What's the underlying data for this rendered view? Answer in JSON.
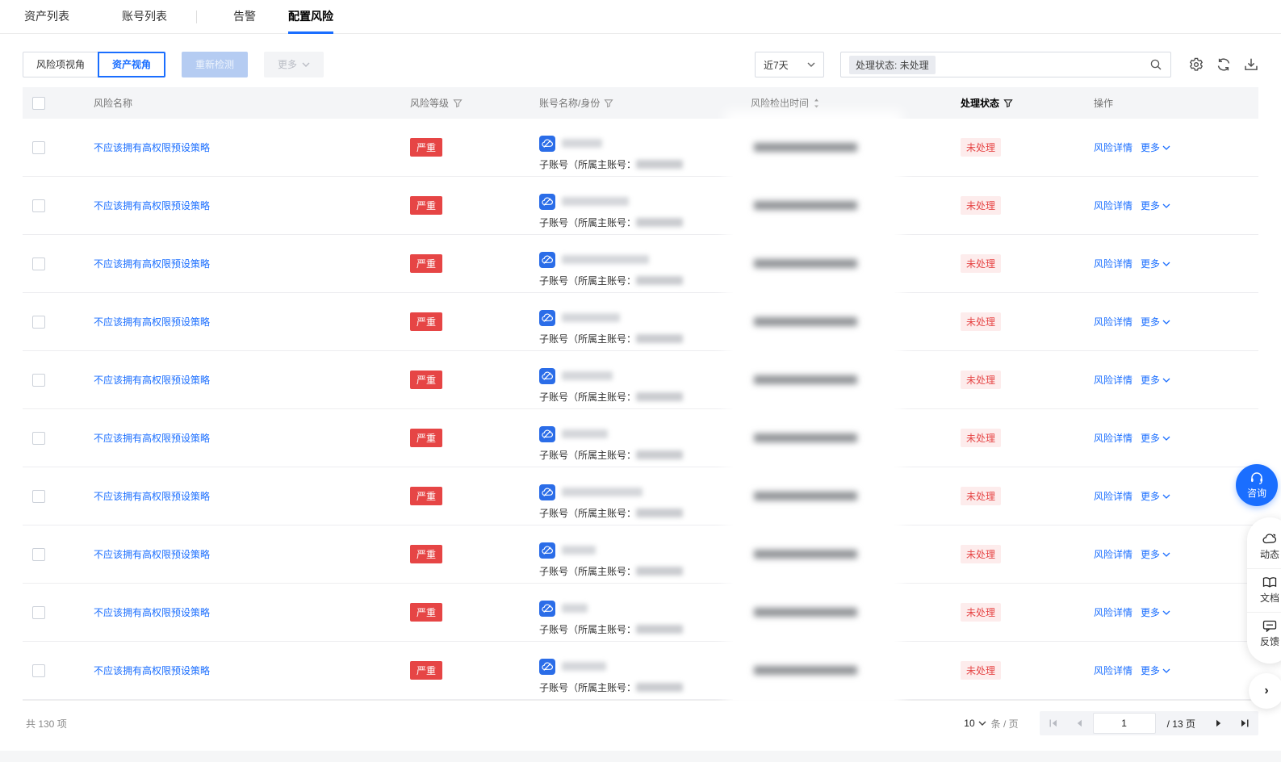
{
  "tabs": {
    "asset_list": "资产列表",
    "account_list": "账号列表",
    "alerts": "告警",
    "config_risk": "配置风险"
  },
  "toolbar": {
    "view_risk_item": "风险项视角",
    "view_asset": "资产视角",
    "redetect": "重新检测",
    "more": "更多",
    "date_range": "近7天",
    "filter_tag": "处理状态: 未处理"
  },
  "table": {
    "headers": {
      "name": "风险名称",
      "severity": "风险等级",
      "account": "账号名称/身份",
      "time": "风险检出时间",
      "status": "处理状态",
      "ops": "操作"
    },
    "rows": [
      {
        "risk_name": "不应该拥有高权限预设策略",
        "severity": "严重",
        "account_line": "子账号（所属主账号：",
        "status": "未处理",
        "action_detail": "风险详情",
        "action_more": "更多",
        "name_blur": 50
      },
      {
        "risk_name": "不应该拥有高权限预设策略",
        "severity": "严重",
        "account_line": "子账号（所属主账号：",
        "status": "未处理",
        "action_detail": "风险详情",
        "action_more": "更多",
        "name_blur": 83
      },
      {
        "risk_name": "不应该拥有高权限预设策略",
        "severity": "严重",
        "account_line": "子账号（所属主账号：",
        "status": "未处理",
        "action_detail": "风险详情",
        "action_more": "更多",
        "name_blur": 108
      },
      {
        "risk_name": "不应该拥有高权限预设策略",
        "severity": "严重",
        "account_line": "子账号（所属主账号：",
        "status": "未处理",
        "action_detail": "风险详情",
        "action_more": "更多",
        "name_blur": 72
      },
      {
        "risk_name": "不应该拥有高权限预设策略",
        "severity": "严重",
        "account_line": "子账号（所属主账号：",
        "status": "未处理",
        "action_detail": "风险详情",
        "action_more": "更多",
        "name_blur": 63
      },
      {
        "risk_name": "不应该拥有高权限预设策略",
        "severity": "严重",
        "account_line": "子账号（所属主账号：",
        "status": "未处理",
        "action_detail": "风险详情",
        "action_more": "更多",
        "name_blur": 57
      },
      {
        "risk_name": "不应该拥有高权限预设策略",
        "severity": "严重",
        "account_line": "子账号（所属主账号：",
        "status": "未处理",
        "action_detail": "风险详情",
        "action_more": "更多",
        "name_blur": 100
      },
      {
        "risk_name": "不应该拥有高权限预设策略",
        "severity": "严重",
        "account_line": "子账号（所属主账号：",
        "status": "未处理",
        "action_detail": "风险详情",
        "action_more": "更多",
        "name_blur": 42
      },
      {
        "risk_name": "不应该拥有高权限预设策略",
        "severity": "严重",
        "account_line": "子账号（所属主账号：",
        "status": "未处理",
        "action_detail": "风险详情",
        "action_more": "更多",
        "name_blur": 32
      },
      {
        "risk_name": "不应该拥有高权限预设策略",
        "severity": "严重",
        "account_line": "子账号（所属主账号：",
        "status": "未处理",
        "action_detail": "风险详情",
        "action_more": "更多",
        "name_blur": 55
      }
    ]
  },
  "footer": {
    "total": "共 130 项",
    "page_size": "10",
    "per_page_unit": "条 / 页",
    "current_page": "1",
    "total_pages": "/ 13 页"
  },
  "floating": {
    "consult": "咨询",
    "news": "动态",
    "docs": "文档",
    "feedback": "反馈"
  },
  "colors": {
    "accent_blue": "#1a6eff",
    "critical_red": "#e64545",
    "status_bg": "#fdecec",
    "header_bg": "#f4f5f7"
  }
}
